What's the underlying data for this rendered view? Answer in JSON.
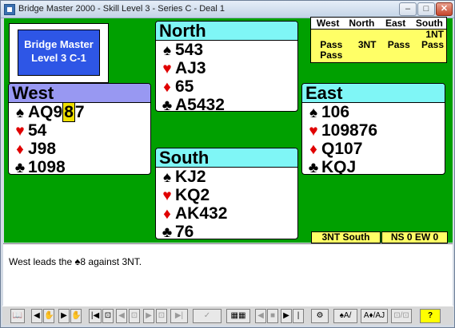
{
  "window": {
    "title": "Bridge Master 2000 - Skill Level 3 - Series C - Deal 1",
    "min": "–",
    "max": "□",
    "close": "✕"
  },
  "logo": {
    "line1": "Bridge Master",
    "line2": "Level 3 C-1"
  },
  "suits": {
    "spade": "♠",
    "heart": "♥",
    "diamond": "♦",
    "club": "♣"
  },
  "hands": {
    "north": {
      "name": "North",
      "spades": "543",
      "hearts": "AJ3",
      "diamonds": "65",
      "clubs": "A5432"
    },
    "west": {
      "name": "West",
      "spades_pre": "AQ9",
      "spades_hl": "8",
      "spades_post": "7",
      "hearts": "54",
      "diamonds": "J98",
      "clubs": "1098"
    },
    "east": {
      "name": "East",
      "spades": "106",
      "hearts": "109876",
      "diamonds": "Q107",
      "clubs": "KQJ"
    },
    "south": {
      "name": "South",
      "spades": "KJ2",
      "hearts": "KQ2",
      "diamonds": "AK432",
      "clubs": "76"
    }
  },
  "bidding": {
    "headers": [
      "West",
      "North",
      "East",
      "South"
    ],
    "row1": [
      "",
      "",
      "",
      "1NT"
    ],
    "row2": [
      "Pass",
      "3NT",
      "Pass",
      "Pass"
    ],
    "row3": [
      "Pass",
      "",
      "",
      ""
    ]
  },
  "status": {
    "contract": "3NT South",
    "score": "NS 0  EW 0"
  },
  "message": {
    "pre": "West leads the ",
    "symbol": "♠",
    "post": "8 against 3NT."
  },
  "toolbar": {
    "btn1": "📖",
    "btn2": "◀",
    "btn3": "✋",
    "btn4": "▶",
    "btn5": "✋",
    "btn6": "|◀",
    "btn7": "⊡",
    "btn8": "◀",
    "btn9": "⊡",
    "btn10": "▶",
    "btn11": "⊡",
    "btn12": "▶|",
    "btn13": "✓",
    "btn14": "▦▦",
    "btn15": "◀",
    "btn16": "■",
    "btn17": "▶",
    "btn18": "|",
    "btn19": "⚙",
    "btn20": "♠A/",
    "btn21": "A♦/AJ",
    "btn22": "⊡/⊡",
    "btn23": "?"
  }
}
